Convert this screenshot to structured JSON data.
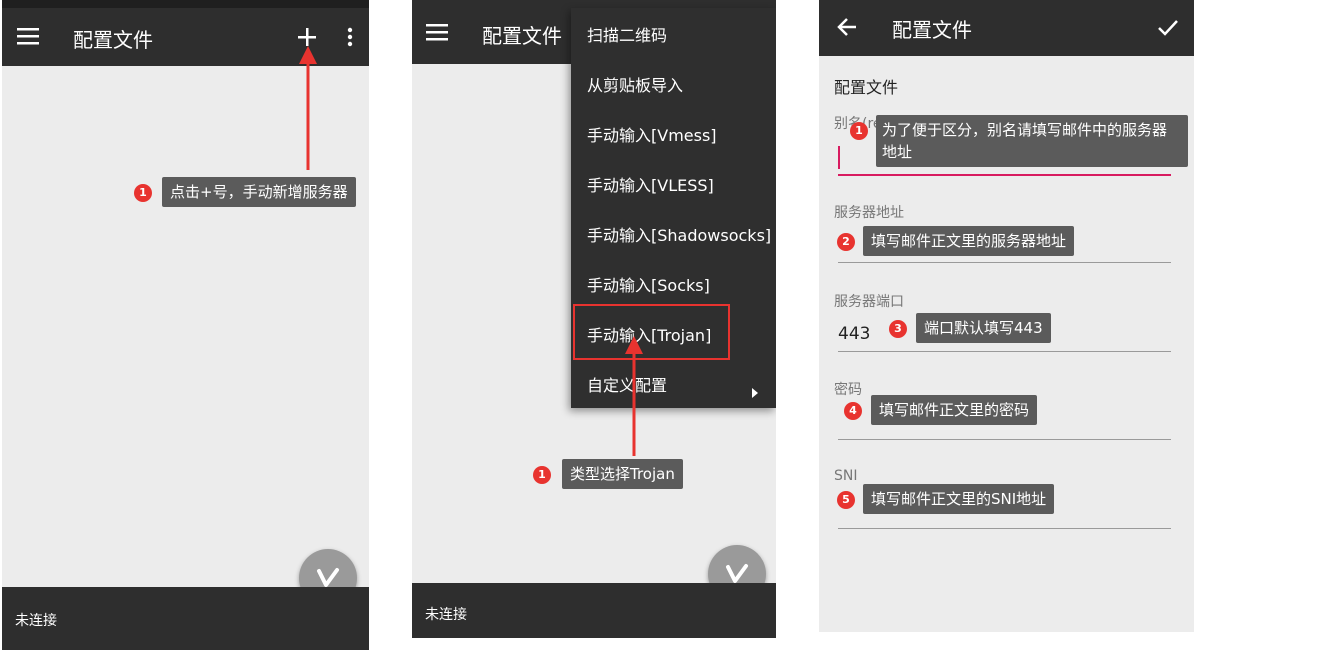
{
  "panel1": {
    "toolbar_title": "配置文件",
    "add_icon": "plus-icon",
    "more_icon": "more-vert-icon",
    "menu_icon": "hamburger-icon",
    "status_text": "未连接",
    "annotation": {
      "number": "1",
      "text": "点击+号，手动新增服务器"
    }
  },
  "panel2": {
    "toolbar_title": "配置文件",
    "menu_items": [
      "扫描二维码",
      "从剪贴板导入",
      "手动输入[Vmess]",
      "手动输入[VLESS]",
      "手动输入[Shadowsocks]",
      "手动输入[Socks]",
      "手动输入[Trojan]",
      "自定义配置"
    ],
    "status_text": "未连接",
    "annotation": {
      "number": "1",
      "text": "类型选择Trojan"
    }
  },
  "panel3": {
    "toolbar_title": "配置文件",
    "back_icon": "arrow-back-icon",
    "confirm_icon": "check-icon",
    "form_title": "配置文件",
    "fields": [
      {
        "label": "别名(remarks)",
        "value": ""
      },
      {
        "label": "服务器地址",
        "value": ""
      },
      {
        "label": "服务器端口",
        "value": "443"
      },
      {
        "label": "密码",
        "value": ""
      },
      {
        "label": "SNI",
        "value": ""
      }
    ],
    "annotations": [
      {
        "number": "1",
        "text_line1": "为了便于区分，别名请填写邮件中的服务器",
        "text_line2": "地址"
      },
      {
        "number": "2",
        "text": "填写邮件正文里的服务器地址"
      },
      {
        "number": "3",
        "text": "端口默认填写443"
      },
      {
        "number": "4",
        "text": "填写邮件正文里的密码"
      },
      {
        "number": "5",
        "text": "填写邮件正文里的SNI地址"
      }
    ]
  },
  "colors": {
    "toolbar": "#2e2e2e",
    "background": "#ececec",
    "annotation_red": "#e8332f",
    "tooltip_gray": "#5b5b5b",
    "cursor_pink": "#d81b60"
  }
}
